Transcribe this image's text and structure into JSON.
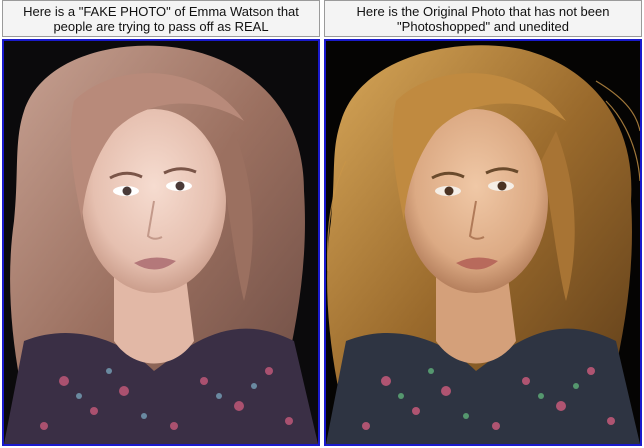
{
  "panels": {
    "left": {
      "caption": "Here is a \"FAKE PHOTO\" of Emma Watson that\npeople are trying to pass off as REAL",
      "photo": "woman-portrait-photo-edited",
      "palette": {
        "bg": "#0b0a0c",
        "hair": "#9b7060",
        "hair_light": "#c8a293",
        "skin": "#f0d0c3",
        "skin_shadow": "#cfa592",
        "lips": "#b4787a",
        "blouse": "#3a2f45"
      }
    },
    "right": {
      "caption": "Here is the Original Photo that has not been\n\"Photoshopped\" and unedited",
      "photo": "woman-portrait-photo-original",
      "palette": {
        "bg": "#050403",
        "hair": "#9a6a2c",
        "hair_light": "#d8a85a",
        "skin": "#e6b994",
        "skin_shadow": "#c08a66",
        "lips": "#b86a5c",
        "blouse": "#2e3442"
      }
    }
  },
  "accent": {
    "frame_border": "#1a1acc",
    "caption_border": "#9a9a9a"
  }
}
